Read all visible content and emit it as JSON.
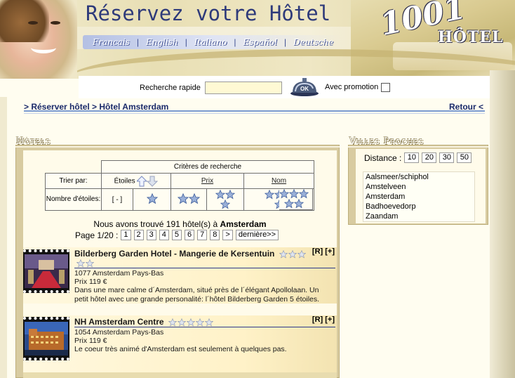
{
  "header": {
    "title": "Réservez votre Hôtel",
    "logo_main": "1001",
    "logo_sub": "HÔTEL",
    "languages": [
      "Francais",
      "English",
      "Italiano",
      "Español",
      "Deutsche"
    ]
  },
  "search": {
    "label": "Recherche rapide",
    "value": "",
    "bell_label": "OK",
    "promo_label": "Avec promotion",
    "promo_checked": false
  },
  "breadcrumb": {
    "left": "> Réserver hôtel > Hôtel Amsterdam",
    "right": "Retour <"
  },
  "hotels": {
    "section_title": "Hôtels",
    "criteria": {
      "title": "Critères de recherche",
      "sort_label": "Trier par:",
      "col_stars": "Étoiles",
      "col_price": "Prix",
      "col_name": "Nom",
      "stars_label": "Nombre d'étoiles:",
      "stars_none": "[ - ]",
      "star_options": [
        1,
        2,
        3,
        4,
        5
      ]
    },
    "found_prefix": "Nous avons trouvé 191 hôtel(s) à",
    "found_city": "Amsterdam",
    "pager": {
      "label": "Page 1/20 :",
      "pages": [
        "1",
        "2",
        "3",
        "4",
        "5",
        "6",
        "7",
        "8",
        ">",
        "dernière>>"
      ]
    },
    "list": [
      {
        "name": "Bilderberg Garden Hotel - Mangerie de Kersentuin",
        "stars": 5,
        "links": "[R] [+]",
        "address": "1077 Amsterdam Pays-Bas",
        "price": "Prix 119 €",
        "description": "Dans une mare calme d´Amsterdam, situé près de l´élégant Apollolaan. Un petit hôtel avec une grande personalité: l´hôtel Bilderberg Garden 5 étoiles."
      },
      {
        "name": "NH Amsterdam Centre",
        "stars": 5,
        "links": "[R] [+]",
        "address": "1054 Amsterdam Pays-Bas",
        "price": "Prix 119 €",
        "description": "Le coeur très animé d'Amsterdam est seulement à quelques pas."
      }
    ]
  },
  "cities": {
    "section_title": "Villes Proches",
    "distance_label": "Distance :",
    "distances": [
      "10",
      "20",
      "30",
      "50"
    ],
    "list": [
      "Aalsmeer/schiphol",
      "Amstelveen",
      "Amsterdam",
      "Badhoevedorp",
      "Zaandam"
    ]
  },
  "colors": {
    "title_blue": "#2e3a7a",
    "link_blue": "#1a2a6a",
    "panel_tan": "#d8cba0",
    "panel_cream": "#fffbea"
  }
}
